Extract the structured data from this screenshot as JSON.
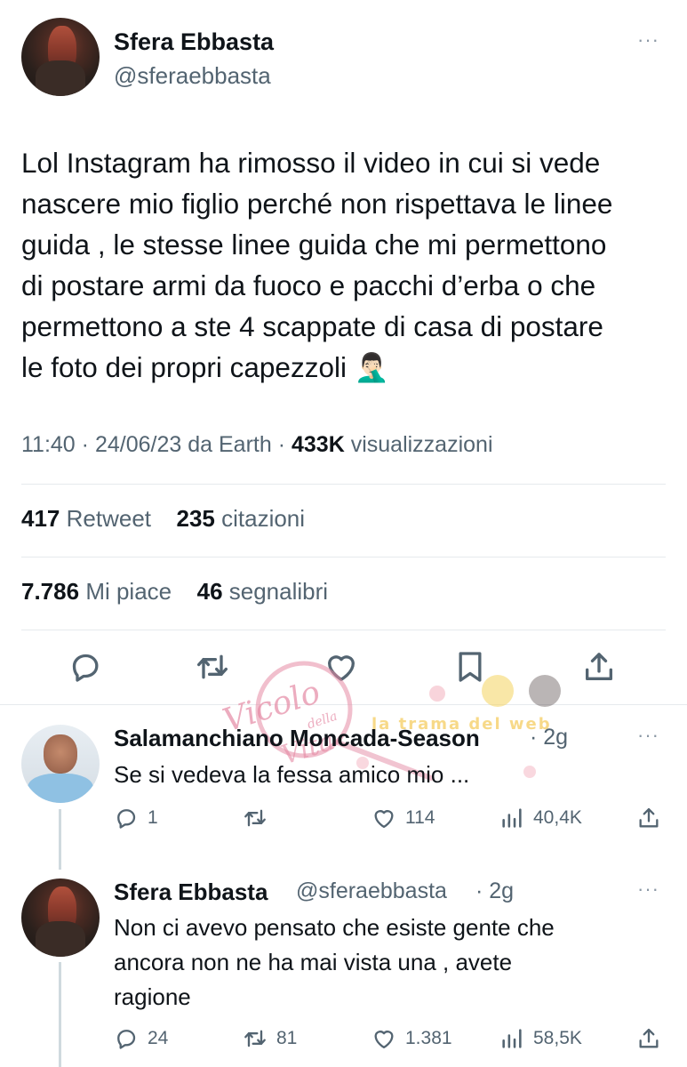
{
  "main_tweet": {
    "author_name": "Sfera Ebbasta",
    "author_handle": "@sferaebbasta",
    "more": "···",
    "text_lines": [
      "Lol Instagram ha rimosso il video in cui si vede",
      "nascere mio figlio perché non rispettava le linee",
      "guida , le stesse linee guida che mi permettono",
      "di postare armi da fuoco e pacchi d’erba o che",
      "permettono a ste 4 scappate di casa di postare",
      "le foto dei propri capezzoli 🤦🏻‍♂️"
    ],
    "meta": {
      "time": "11:40",
      "sep1": "·",
      "date": "24/06/23",
      "source": "da Earth",
      "sep2": "·",
      "views_count": "433K",
      "views_label": "visualizzazioni"
    },
    "stats": {
      "retweets_count": "417",
      "retweets_label": "Retweet",
      "quotes_count": "235",
      "quotes_label": "citazioni",
      "likes_count": "7.786",
      "likes_label": "Mi piace",
      "bookmarks_count": "46",
      "bookmarks_label": "segnalibri"
    },
    "actions": [
      "reply-icon",
      "retweet-icon",
      "like-icon",
      "bookmark-icon",
      "share-icon"
    ]
  },
  "watermark": {
    "script_text": "Vicolo",
    "small_text": "della",
    "script_text2": "Vita",
    "banner_text": "la trama del web"
  },
  "replies": [
    {
      "author_name": "Salamanchiano Moncada-Season",
      "meta": "· 2g",
      "more": "···",
      "text_lines": [
        "Se si vedeva la fessa amico mio ..."
      ],
      "stats": {
        "replies": "1",
        "retweets": "",
        "likes": "114",
        "views": "40,4K"
      }
    },
    {
      "author_name": "Sfera Ebbasta",
      "author_handle": "@sferaebbasta",
      "meta": "· 2g",
      "more": "···",
      "text_lines": [
        "Non ci avevo pensato che esiste gente che",
        "ancora non ne ha mai vista una , avete",
        "ragione"
      ],
      "stats": {
        "replies": "24",
        "retweets": "81",
        "likes": "1.381",
        "views": "58,5K"
      }
    }
  ],
  "colors": {
    "text": "#0f1419",
    "secondary": "#536471",
    "divider": "#e6eaed",
    "thread_line": "#cfd9de",
    "watermark_pink": "#e58aa4"
  }
}
